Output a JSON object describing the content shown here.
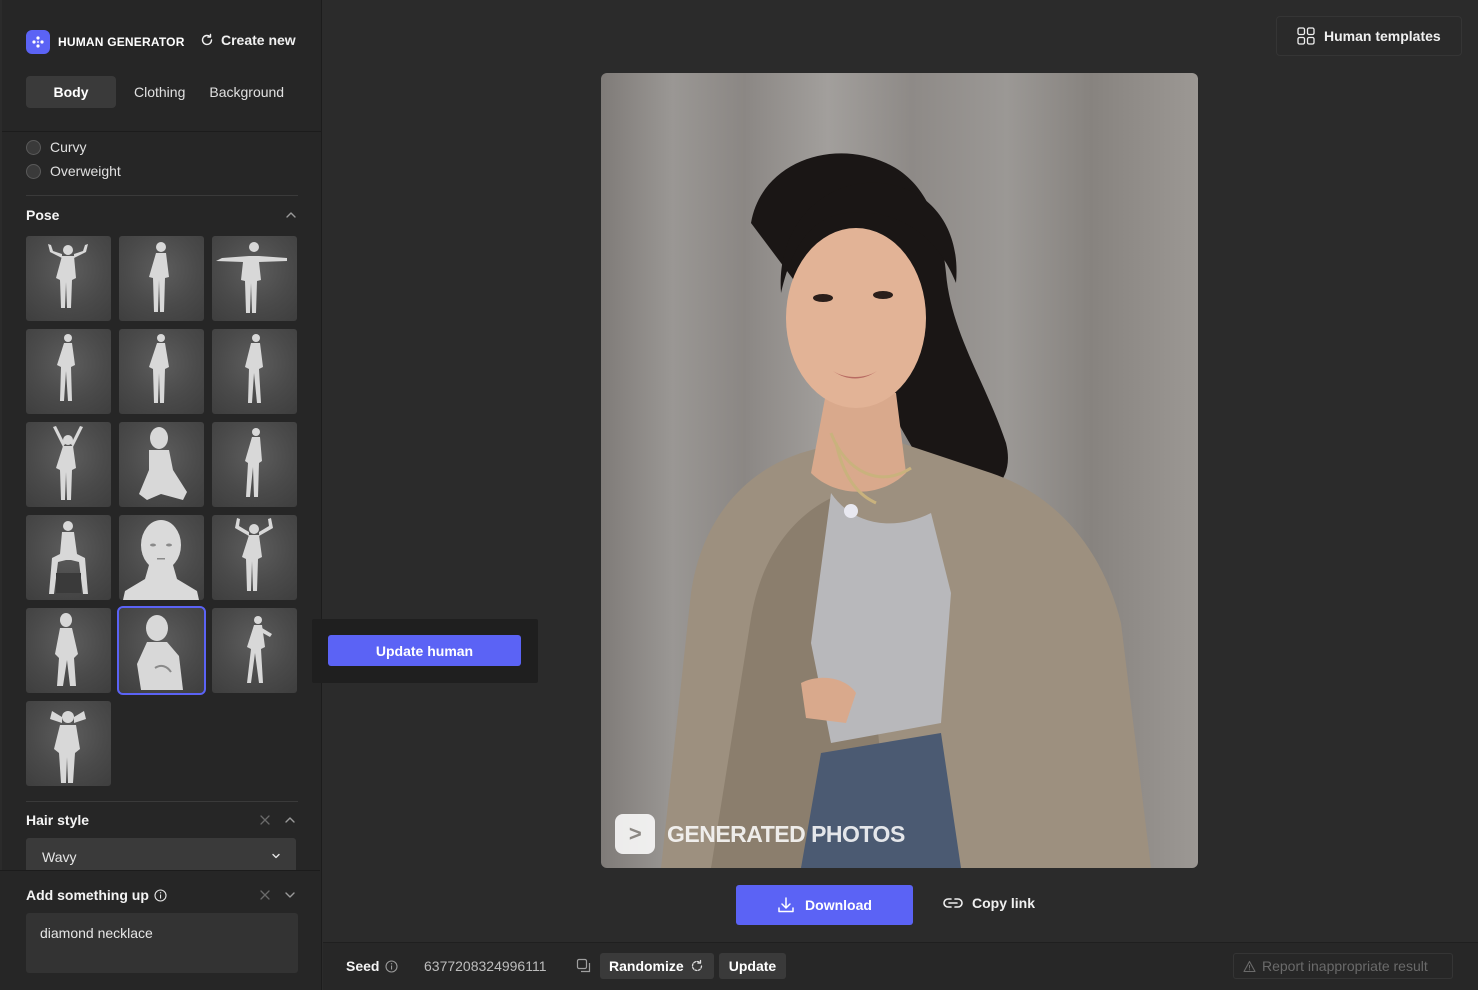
{
  "brand": {
    "name": "HUMAN GENERATOR"
  },
  "header": {
    "create_new": "Create new",
    "templates": "Human templates"
  },
  "tabs": [
    {
      "label": "Body",
      "active": true
    },
    {
      "label": "Clothing",
      "active": false
    },
    {
      "label": "Background",
      "active": false
    }
  ],
  "body_type": {
    "options": [
      "Curvy",
      "Overweight"
    ]
  },
  "pose": {
    "title": "Pose",
    "thumbnails": 16,
    "selected_index": 13
  },
  "tooltip": {
    "update_human": "Update human"
  },
  "hair_style": {
    "title": "Hair style",
    "value": "Wavy"
  },
  "add_something": {
    "title": "Add something up",
    "value": "diamond necklace"
  },
  "preview": {
    "watermark": "GENERATED PHOTOS",
    "watermark_logo": ">"
  },
  "actions": {
    "download": "Download",
    "copy_link": "Copy link"
  },
  "seed": {
    "label": "Seed",
    "value": "6377208324996111",
    "randomize": "Randomize",
    "update": "Update",
    "report": "Report inappropriate result"
  },
  "colors": {
    "accent": "#5b63f5",
    "background": "#2b2b2b",
    "sidebar": "#262626"
  }
}
